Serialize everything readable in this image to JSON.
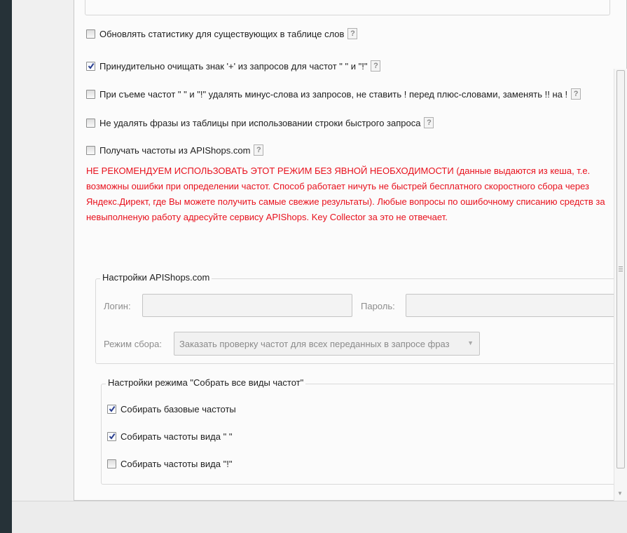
{
  "options": [
    {
      "label": "Обновлять статистику для существующих в таблице слов",
      "checked": false,
      "help": "?"
    },
    {
      "label": "Принудительно очищать знак '+' из запросов для частот \" \" и \"!\"",
      "checked": true,
      "help": "?"
    },
    {
      "label": "При съеме частот \" \" и \"!\" удалять минус-слова из запросов, не ставить ! перед плюс-словами, заменять !! на !",
      "checked": false,
      "help": "?"
    },
    {
      "label": "Не удалять фразы из таблицы при использовании строки быстрого запроса",
      "checked": false,
      "help": "?"
    },
    {
      "label": "Получать частоты из APIShops.com",
      "checked": false,
      "help": "?"
    }
  ],
  "warning": {
    "caps": "НЕ РЕКОМЕНДУЕМ ИСПОЛЬЗОВАТЬ ЭТОТ РЕЖИМ БЕЗ ЯВНОЙ НЕОБХОДИМОСТИ",
    "text": " (данные выдаются из кеша, т.е. возможны ошибки при определении частот. Способ работает ничуть не быстрей бесплатного скоростного сбора через Яндекс.Директ, где Вы можете получить самые свежие результаты). Любые вопросы по ошибочному списанию средств за невыполненую работу адресуйте сервису APIShops. Key Collector за это не отвечает."
  },
  "apishops": {
    "title": "Настройки APIShops.com",
    "login_label": "Логин:",
    "login_value": "",
    "password_label": "Пароль:",
    "password_value": "",
    "mode_label": "Режим сбора:",
    "mode_value": "Заказать проверку частот для всех переданных в запросе фраз"
  },
  "collect_all": {
    "title": "Настройки режима \"Собрать все виды частот\"",
    "items": [
      {
        "label": "Собирать базовые частоты",
        "checked": true
      },
      {
        "label": "Собирать частоты вида \" \"",
        "checked": true
      },
      {
        "label": "Собирать частоты вида \"!\"",
        "checked": false
      }
    ]
  },
  "colors": {
    "warning": "#e8101c",
    "background_dark": "#263238",
    "panel": "#fbfbfb"
  }
}
